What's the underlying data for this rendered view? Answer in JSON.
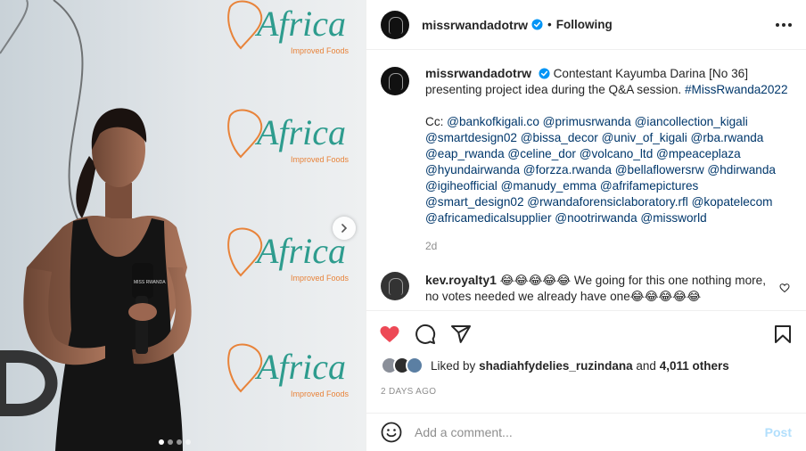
{
  "post": {
    "username": "missrwandadotrw",
    "follow_status": "Following",
    "separator": "•",
    "caption_text": "Contestant Kayumba Darina [No 36] presenting project idea during the Q&A session.",
    "caption_hashtag": "#MissRwanda2022",
    "cc_label": "Cc:",
    "cc_tags": "@bankofkigali.co @primusrwanda @iancollection_kigali @smartdesign02 @bissa_decor @univ_of_kigali @rba.rwanda @eap_rwanda @celine_dor @volcano_ltd @mpeaceplaza @hyundairwanda @forzza.rwanda @bellaflowersrw @hdirwanda @igiheofficial @manudy_emma @afrifamepictures @smart_design02 @rwandaforensiclaboratory.rfl @kopatelecom @africamedicalsupplier @nootrirwanda @missworld",
    "caption_time": "2d"
  },
  "comment": {
    "username": "kev.royalty1",
    "text": "😂😂😂😂😂 We going for this one nothing more, no votes needed we already have one😂😂😂😂😂"
  },
  "likes": {
    "prefix": "Liked by",
    "user": "shadiahfydelies_ruzindana",
    "and": "and",
    "count": "4,011 others"
  },
  "posted_ago": "2 DAYS AGO",
  "add_comment": {
    "placeholder": "Add a comment...",
    "post_label": "Post"
  },
  "photo": {
    "backdrop_logo": "Africa",
    "backdrop_sub": "Improved Foods",
    "mic_label": "MISS RWANDA",
    "carousel_count": 4,
    "carousel_active": 0
  },
  "colors": {
    "like_red": "#ed4956",
    "link_blue": "#00376b",
    "verified_blue": "#0095f6",
    "logo_green": "#2e9c8e",
    "logo_orange": "#e8833a"
  },
  "icons": [
    "heart-icon",
    "comment-icon",
    "share-icon",
    "bookmark-icon",
    "emoji-icon",
    "verified-icon",
    "more-icon",
    "chevron-right-icon"
  ]
}
